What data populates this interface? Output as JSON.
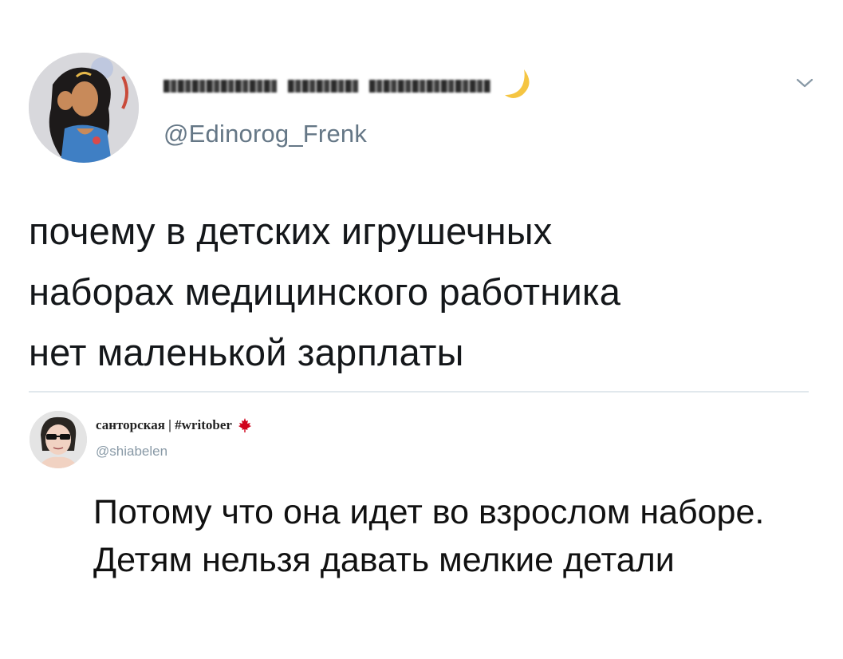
{
  "main_tweet": {
    "handle": "@Edinorog_Frenk",
    "text_lines": [
      "почему в детских игрушечных",
      "наборах медицинского работника",
      "нет маленькой зарплаты"
    ],
    "avatar_icon": "woman-portrait-avatar",
    "name_emoji": "crescent-moon-icon",
    "menu_icon": "chevron-down-icon"
  },
  "reply": {
    "display_name": "санторская | #writober",
    "name_emoji": "maple-leaf-icon",
    "handle": "@shiabelen",
    "text_lines": [
      "Потому что она идет во взрослом наборе.",
      "Детям нельзя давать мелкие детали"
    ],
    "avatar_icon": "person-sunglasses-avatar"
  },
  "colors": {
    "secondary_text": "#657786",
    "divider": "#e1e8ed",
    "moon": "#f5c542",
    "maple_leaf": "#d0021b"
  }
}
